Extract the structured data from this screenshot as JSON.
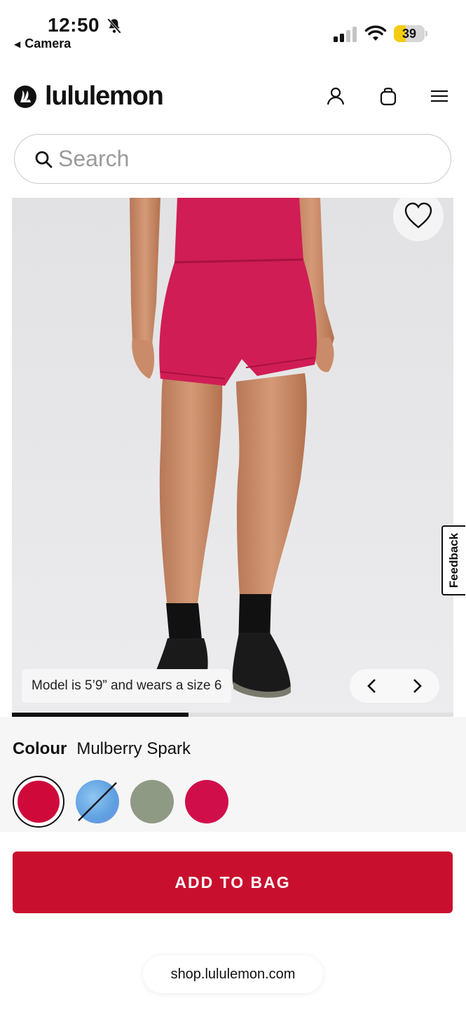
{
  "status_bar": {
    "time": "12:50",
    "back_app": "Camera",
    "battery": "39",
    "battery_level": 0.39
  },
  "header": {
    "brand": "lululemon"
  },
  "search": {
    "placeholder": "Search"
  },
  "gallery": {
    "caption": "Model is 5’9” and wears a size 6",
    "image_progress": 0.4,
    "feedback_label": "Feedback"
  },
  "colour": {
    "label": "Colour",
    "selected": "Mulberry Spark",
    "swatches": [
      "#cf0a3a",
      "#6aaee6",
      "#8f9a84",
      "#d00f4a"
    ]
  },
  "actions": {
    "add_to_bag": "ADD TO BAG"
  },
  "browser": {
    "url": "shop.lululemon.com"
  },
  "colors": {
    "accent": "#c8102e",
    "shorts": "#d01d55"
  }
}
